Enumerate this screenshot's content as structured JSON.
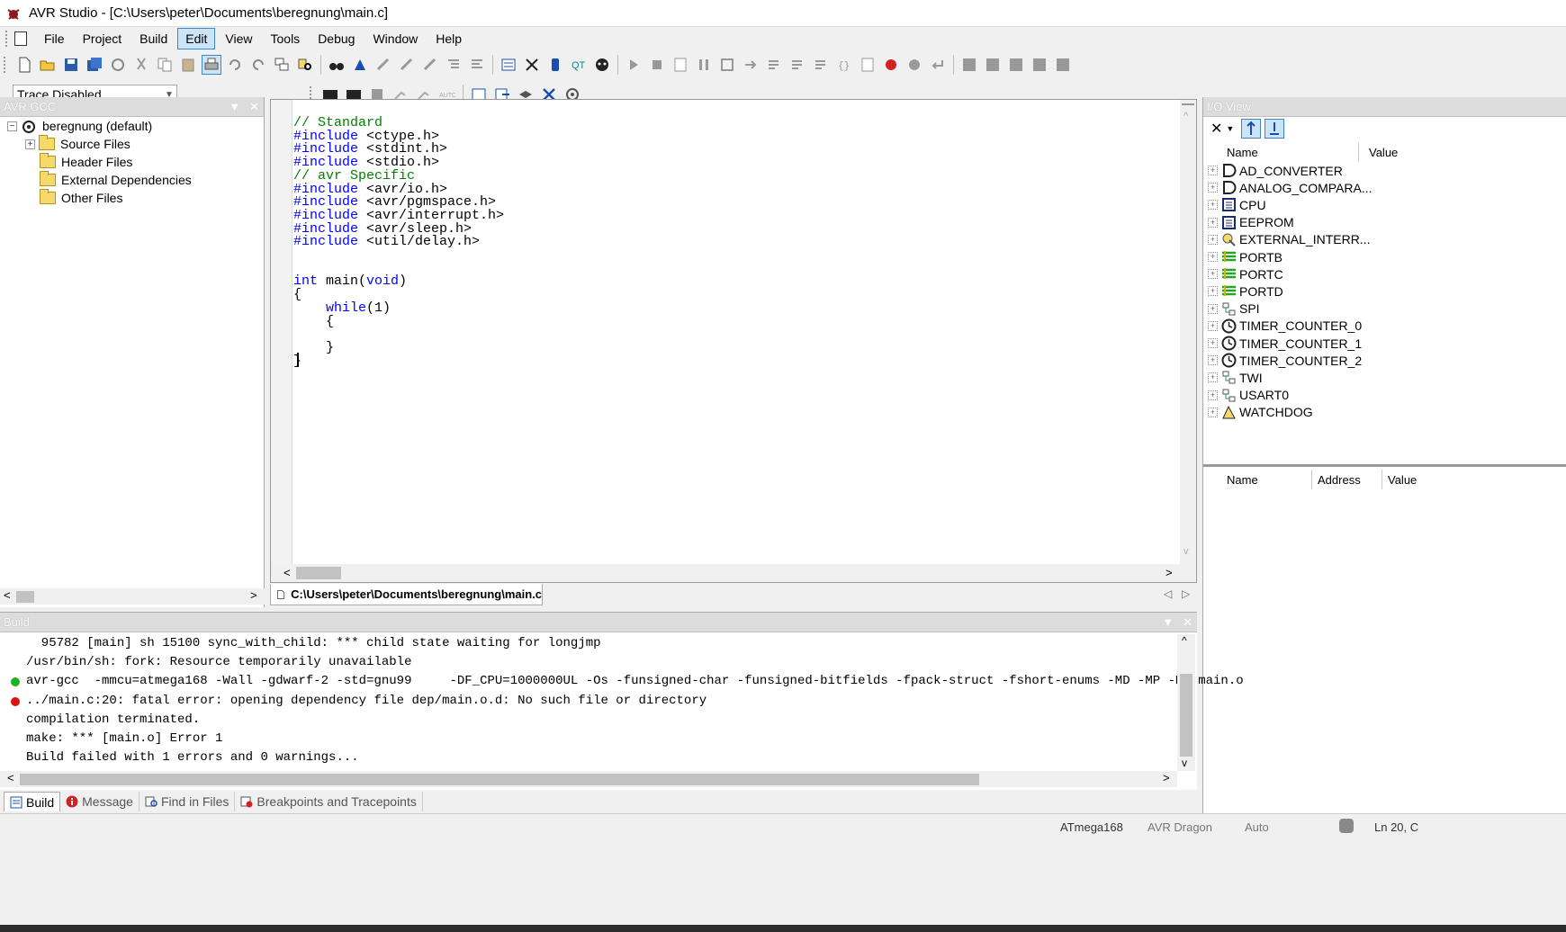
{
  "window": {
    "title": "AVR Studio - [C:\\Users\\peter\\Documents\\beregnung\\main.c]"
  },
  "menu": [
    "File",
    "Project",
    "Build",
    "Edit",
    "View",
    "Tools",
    "Debug",
    "Window",
    "Help"
  ],
  "menu_active": "Edit",
  "trace": {
    "selected": "Trace Disabled"
  },
  "project_panel": {
    "title": "AVR GCC",
    "root": "beregnung (default)",
    "items": [
      "Source Files",
      "Header Files",
      "External Dependencies",
      "Other Files"
    ]
  },
  "editor": {
    "lines": [
      {
        "parts": [
          {
            "t": "// Standard",
            "c": "cm"
          }
        ]
      },
      {
        "parts": [
          {
            "t": "#include",
            "c": "kw"
          },
          {
            "t": " <ctype.h>",
            "c": "tx"
          }
        ]
      },
      {
        "parts": [
          {
            "t": "#include",
            "c": "kw"
          },
          {
            "t": " <stdint.h>",
            "c": "tx"
          }
        ]
      },
      {
        "parts": [
          {
            "t": "#include",
            "c": "kw"
          },
          {
            "t": " <stdio.h>",
            "c": "tx"
          }
        ]
      },
      {
        "parts": [
          {
            "t": "// avr Specific",
            "c": "cm"
          }
        ]
      },
      {
        "parts": [
          {
            "t": "#include",
            "c": "kw"
          },
          {
            "t": " <avr/io.h>",
            "c": "tx"
          }
        ]
      },
      {
        "parts": [
          {
            "t": "#include",
            "c": "kw"
          },
          {
            "t": " <avr/pgmspace.h>",
            "c": "tx"
          }
        ]
      },
      {
        "parts": [
          {
            "t": "#include",
            "c": "kw"
          },
          {
            "t": " <avr/interrupt.h>",
            "c": "tx"
          }
        ]
      },
      {
        "parts": [
          {
            "t": "#include",
            "c": "kw"
          },
          {
            "t": " <avr/sleep.h>",
            "c": "tx"
          }
        ]
      },
      {
        "parts": [
          {
            "t": "#include",
            "c": "kw"
          },
          {
            "t": " <util/delay.h>",
            "c": "tx"
          }
        ]
      },
      {
        "parts": []
      },
      {
        "parts": []
      },
      {
        "parts": [
          {
            "t": "int",
            "c": "kw"
          },
          {
            "t": " main(",
            "c": "tx"
          },
          {
            "t": "void",
            "c": "kw"
          },
          {
            "t": ")",
            "c": "tx"
          }
        ]
      },
      {
        "parts": [
          {
            "t": "{",
            "c": "tx"
          }
        ]
      },
      {
        "parts": [
          {
            "t": "    ",
            "c": "tx"
          },
          {
            "t": "while",
            "c": "kw"
          },
          {
            "t": "(1)",
            "c": "tx"
          }
        ]
      },
      {
        "parts": [
          {
            "t": "    {",
            "c": "tx"
          }
        ]
      },
      {
        "parts": []
      },
      {
        "parts": [
          {
            "t": "    }",
            "c": "tx"
          }
        ]
      },
      {
        "parts": [
          {
            "t": "}",
            "c": "tx"
          }
        ]
      }
    ],
    "tab_label": "C:\\Users\\peter\\Documents\\beregnung\\main.c"
  },
  "io_view": {
    "title": "I/O View",
    "columns": [
      "Name",
      "Value"
    ],
    "items": [
      {
        "name": "AD_CONVERTER",
        "icon": "adc-icon"
      },
      {
        "name": "ANALOG_COMPARA...",
        "icon": "comparator-icon"
      },
      {
        "name": "CPU",
        "icon": "cpu-icon"
      },
      {
        "name": "EEPROM",
        "icon": "eeprom-icon"
      },
      {
        "name": "EXTERNAL_INTERR...",
        "icon": "interrupt-icon"
      },
      {
        "name": "PORTB",
        "icon": "port-icon"
      },
      {
        "name": "PORTC",
        "icon": "port-icon"
      },
      {
        "name": "PORTD",
        "icon": "port-icon"
      },
      {
        "name": "SPI",
        "icon": "bus-icon"
      },
      {
        "name": "TIMER_COUNTER_0",
        "icon": "timer-icon"
      },
      {
        "name": "TIMER_COUNTER_1",
        "icon": "timer-icon"
      },
      {
        "name": "TIMER_COUNTER_2",
        "icon": "timer-icon"
      },
      {
        "name": "TWI",
        "icon": "bus-icon"
      },
      {
        "name": "USART0",
        "icon": "bus-icon"
      },
      {
        "name": "WATCHDOG",
        "icon": "watchdog-icon"
      }
    ],
    "detail_columns": [
      "Name",
      "Address",
      "Value"
    ]
  },
  "build_panel": {
    "title": "Build",
    "lines": [
      {
        "text": "  95782 [main] sh 15100 sync_with_child: *** child state waiting for longjmp",
        "dot": null
      },
      {
        "text": "/usr/bin/sh: fork: Resource temporarily unavailable",
        "dot": null
      },
      {
        "text": "avr-gcc  -mmcu=atmega168 -Wall -gdwarf-2 -std=gnu99     -DF_CPU=1000000UL -Os -funsigned-char -funsigned-bitfields -fpack-struct -fshort-enums -MD -MP -MT main.o",
        "dot": "#1db31d"
      },
      {
        "text": "../main.c:20: fatal error: opening dependency file dep/main.o.d: No such file or directory",
        "dot": "#e01010"
      },
      {
        "text": "compilation terminated.",
        "dot": null
      },
      {
        "text": "make: *** [main.o] Error 1",
        "dot": null
      },
      {
        "text": "Build failed with 1 errors and 0 warnings...",
        "dot": null
      }
    ]
  },
  "bottom_tabs": [
    "Build",
    "Message",
    "Find in Files",
    "Breakpoints and Tracepoints"
  ],
  "status": {
    "device": "ATmega168",
    "tool": "AVR Dragon",
    "mode": "Auto",
    "position": "Ln 20, C"
  },
  "colors": {
    "keyword": "#0000ff",
    "comment": "#008000",
    "success_dot": "#1db31d",
    "error_dot": "#e01010"
  }
}
